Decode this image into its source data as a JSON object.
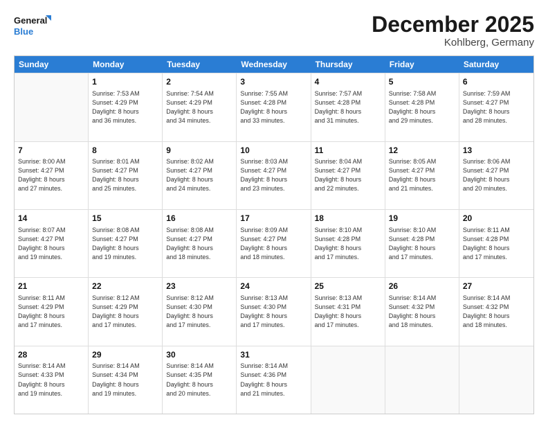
{
  "logo": {
    "line1": "General",
    "line2": "Blue"
  },
  "title": "December 2025",
  "location": "Kohlberg, Germany",
  "days_header": [
    "Sunday",
    "Monday",
    "Tuesday",
    "Wednesday",
    "Thursday",
    "Friday",
    "Saturday"
  ],
  "weeks": [
    [
      {
        "day": "",
        "info": ""
      },
      {
        "day": "1",
        "info": "Sunrise: 7:53 AM\nSunset: 4:29 PM\nDaylight: 8 hours\nand 36 minutes."
      },
      {
        "day": "2",
        "info": "Sunrise: 7:54 AM\nSunset: 4:29 PM\nDaylight: 8 hours\nand 34 minutes."
      },
      {
        "day": "3",
        "info": "Sunrise: 7:55 AM\nSunset: 4:28 PM\nDaylight: 8 hours\nand 33 minutes."
      },
      {
        "day": "4",
        "info": "Sunrise: 7:57 AM\nSunset: 4:28 PM\nDaylight: 8 hours\nand 31 minutes."
      },
      {
        "day": "5",
        "info": "Sunrise: 7:58 AM\nSunset: 4:28 PM\nDaylight: 8 hours\nand 29 minutes."
      },
      {
        "day": "6",
        "info": "Sunrise: 7:59 AM\nSunset: 4:27 PM\nDaylight: 8 hours\nand 28 minutes."
      }
    ],
    [
      {
        "day": "7",
        "info": "Sunrise: 8:00 AM\nSunset: 4:27 PM\nDaylight: 8 hours\nand 27 minutes."
      },
      {
        "day": "8",
        "info": "Sunrise: 8:01 AM\nSunset: 4:27 PM\nDaylight: 8 hours\nand 25 minutes."
      },
      {
        "day": "9",
        "info": "Sunrise: 8:02 AM\nSunset: 4:27 PM\nDaylight: 8 hours\nand 24 minutes."
      },
      {
        "day": "10",
        "info": "Sunrise: 8:03 AM\nSunset: 4:27 PM\nDaylight: 8 hours\nand 23 minutes."
      },
      {
        "day": "11",
        "info": "Sunrise: 8:04 AM\nSunset: 4:27 PM\nDaylight: 8 hours\nand 22 minutes."
      },
      {
        "day": "12",
        "info": "Sunrise: 8:05 AM\nSunset: 4:27 PM\nDaylight: 8 hours\nand 21 minutes."
      },
      {
        "day": "13",
        "info": "Sunrise: 8:06 AM\nSunset: 4:27 PM\nDaylight: 8 hours\nand 20 minutes."
      }
    ],
    [
      {
        "day": "14",
        "info": "Sunrise: 8:07 AM\nSunset: 4:27 PM\nDaylight: 8 hours\nand 19 minutes."
      },
      {
        "day": "15",
        "info": "Sunrise: 8:08 AM\nSunset: 4:27 PM\nDaylight: 8 hours\nand 19 minutes."
      },
      {
        "day": "16",
        "info": "Sunrise: 8:08 AM\nSunset: 4:27 PM\nDaylight: 8 hours\nand 18 minutes."
      },
      {
        "day": "17",
        "info": "Sunrise: 8:09 AM\nSunset: 4:27 PM\nDaylight: 8 hours\nand 18 minutes."
      },
      {
        "day": "18",
        "info": "Sunrise: 8:10 AM\nSunset: 4:28 PM\nDaylight: 8 hours\nand 17 minutes."
      },
      {
        "day": "19",
        "info": "Sunrise: 8:10 AM\nSunset: 4:28 PM\nDaylight: 8 hours\nand 17 minutes."
      },
      {
        "day": "20",
        "info": "Sunrise: 8:11 AM\nSunset: 4:28 PM\nDaylight: 8 hours\nand 17 minutes."
      }
    ],
    [
      {
        "day": "21",
        "info": "Sunrise: 8:11 AM\nSunset: 4:29 PM\nDaylight: 8 hours\nand 17 minutes."
      },
      {
        "day": "22",
        "info": "Sunrise: 8:12 AM\nSunset: 4:29 PM\nDaylight: 8 hours\nand 17 minutes."
      },
      {
        "day": "23",
        "info": "Sunrise: 8:12 AM\nSunset: 4:30 PM\nDaylight: 8 hours\nand 17 minutes."
      },
      {
        "day": "24",
        "info": "Sunrise: 8:13 AM\nSunset: 4:30 PM\nDaylight: 8 hours\nand 17 minutes."
      },
      {
        "day": "25",
        "info": "Sunrise: 8:13 AM\nSunset: 4:31 PM\nDaylight: 8 hours\nand 17 minutes."
      },
      {
        "day": "26",
        "info": "Sunrise: 8:14 AM\nSunset: 4:32 PM\nDaylight: 8 hours\nand 18 minutes."
      },
      {
        "day": "27",
        "info": "Sunrise: 8:14 AM\nSunset: 4:32 PM\nDaylight: 8 hours\nand 18 minutes."
      }
    ],
    [
      {
        "day": "28",
        "info": "Sunrise: 8:14 AM\nSunset: 4:33 PM\nDaylight: 8 hours\nand 19 minutes."
      },
      {
        "day": "29",
        "info": "Sunrise: 8:14 AM\nSunset: 4:34 PM\nDaylight: 8 hours\nand 19 minutes."
      },
      {
        "day": "30",
        "info": "Sunrise: 8:14 AM\nSunset: 4:35 PM\nDaylight: 8 hours\nand 20 minutes."
      },
      {
        "day": "31",
        "info": "Sunrise: 8:14 AM\nSunset: 4:36 PM\nDaylight: 8 hours\nand 21 minutes."
      },
      {
        "day": "",
        "info": ""
      },
      {
        "day": "",
        "info": ""
      },
      {
        "day": "",
        "info": ""
      }
    ]
  ]
}
